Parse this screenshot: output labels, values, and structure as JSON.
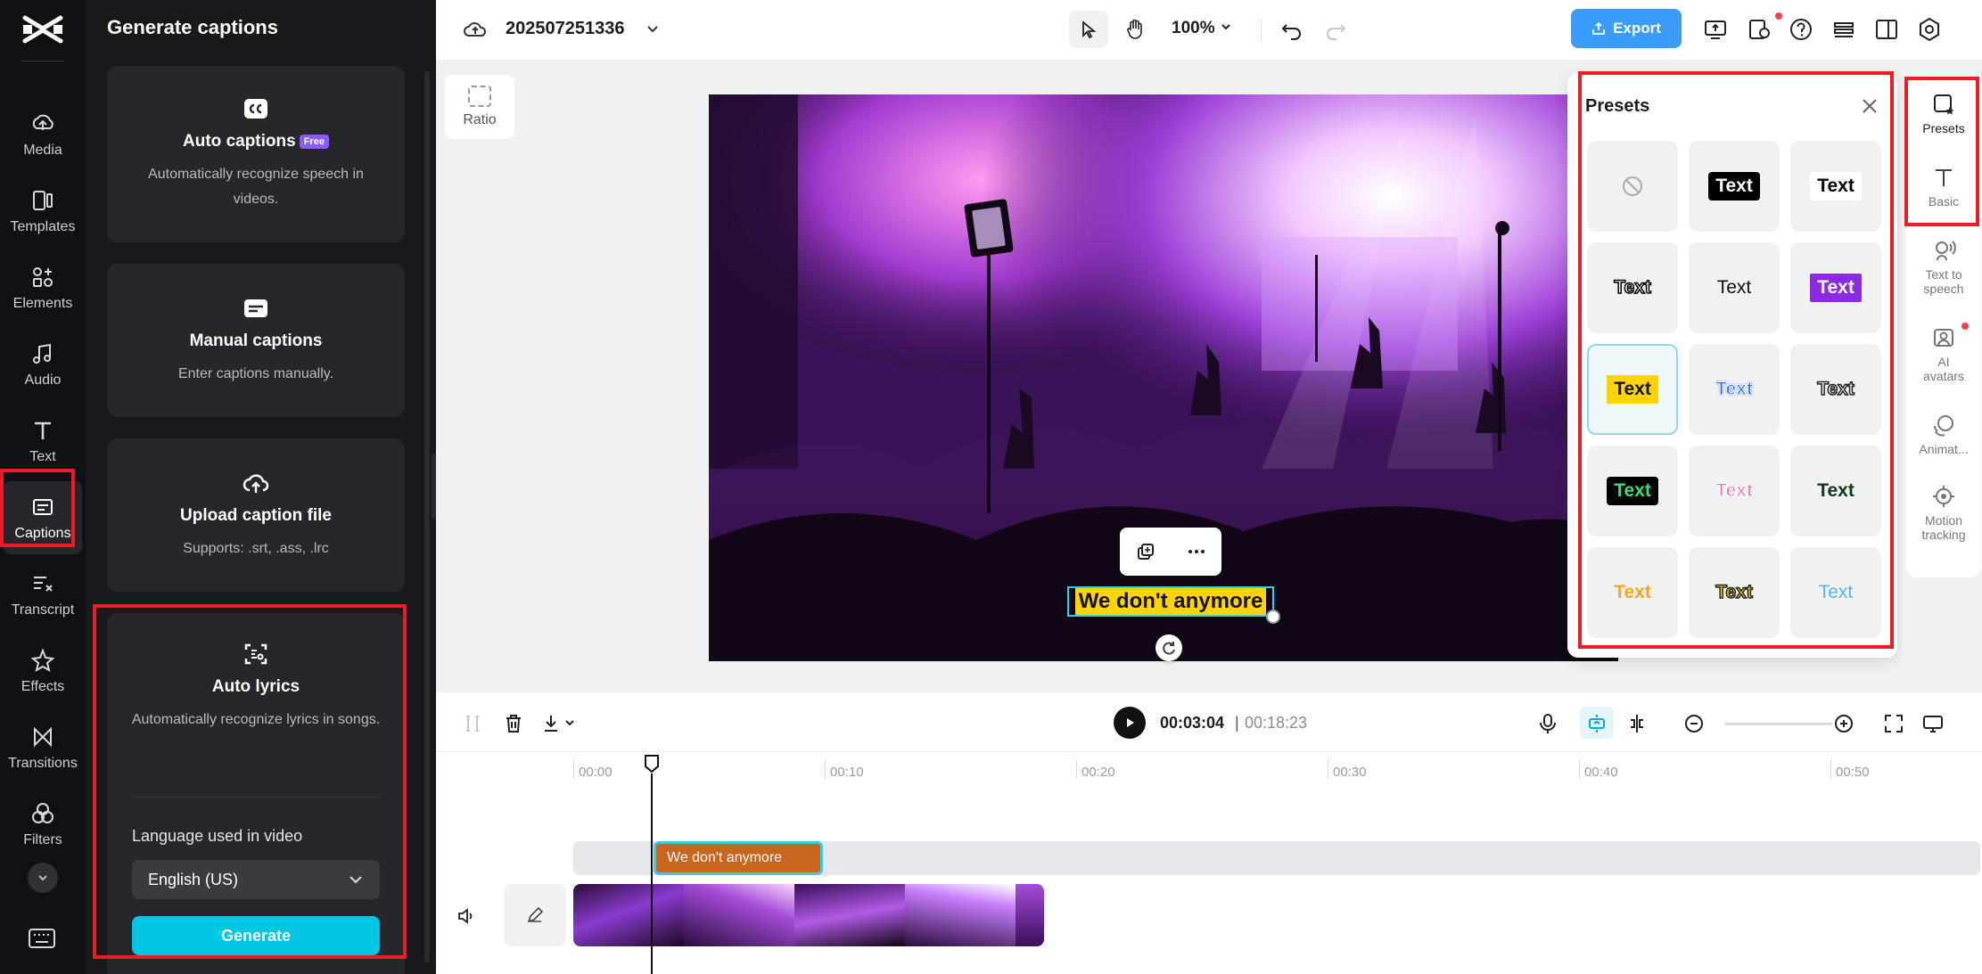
{
  "nav": {
    "items": [
      {
        "label": "Media",
        "icon": "media-icon"
      },
      {
        "label": "Templates",
        "icon": "templates-icon"
      },
      {
        "label": "Elements",
        "icon": "elements-icon"
      },
      {
        "label": "Audio",
        "icon": "audio-icon"
      },
      {
        "label": "Text",
        "icon": "text-icon"
      },
      {
        "label": "Captions",
        "icon": "captions-icon",
        "active": true
      },
      {
        "label": "Transcript",
        "icon": "transcript-icon"
      },
      {
        "label": "Effects",
        "icon": "effects-icon"
      },
      {
        "label": "Transitions",
        "icon": "transitions-icon"
      },
      {
        "label": "Filters",
        "icon": "filters-icon"
      }
    ]
  },
  "panel": {
    "title": "Generate captions",
    "auto_captions": {
      "title": "Auto captions",
      "badge": "Free",
      "desc": "Automatically recognize speech in videos."
    },
    "manual_captions": {
      "title": "Manual captions",
      "desc": "Enter captions manually."
    },
    "upload_caption": {
      "title": "Upload caption file",
      "desc": "Supports: .srt, .ass, .lrc"
    },
    "auto_lyrics": {
      "title": "Auto lyrics",
      "desc": "Automatically recognize lyrics in songs."
    },
    "language_label": "Language used in video",
    "language_value": "English (US)",
    "generate_label": "Generate"
  },
  "topbar": {
    "project_title": "202507251336",
    "zoom": "100%",
    "export_label": "Export"
  },
  "canvas": {
    "ratio_label": "Ratio",
    "caption_text": "We don't anymore"
  },
  "presets": {
    "title": "Presets",
    "sample_text": "Text"
  },
  "rail": {
    "items": [
      {
        "label": "Presets",
        "icon": "presets-icon",
        "active": true
      },
      {
        "label": "Basic",
        "icon": "basic-text-icon"
      },
      {
        "label": "Text to speech",
        "icon": "text-to-speech-icon"
      },
      {
        "label": "AI avatars",
        "icon": "ai-avatars-icon"
      },
      {
        "label": "Animat...",
        "icon": "animation-icon"
      },
      {
        "label": "Motion tracking",
        "icon": "motion-tracking-icon"
      }
    ]
  },
  "timeline": {
    "current_time": "00:03:04",
    "separator": "|",
    "duration": "00:18:23",
    "ruler": [
      "00:00",
      "00:10",
      "00:20",
      "00:30",
      "00:40",
      "00:50"
    ],
    "text_clip": "We don't anymore"
  },
  "colors": {
    "accent": "#00c6e4",
    "export": "#3b9cff",
    "highlight_box": "#ee1c24",
    "caption_bg": "#ffd400"
  }
}
